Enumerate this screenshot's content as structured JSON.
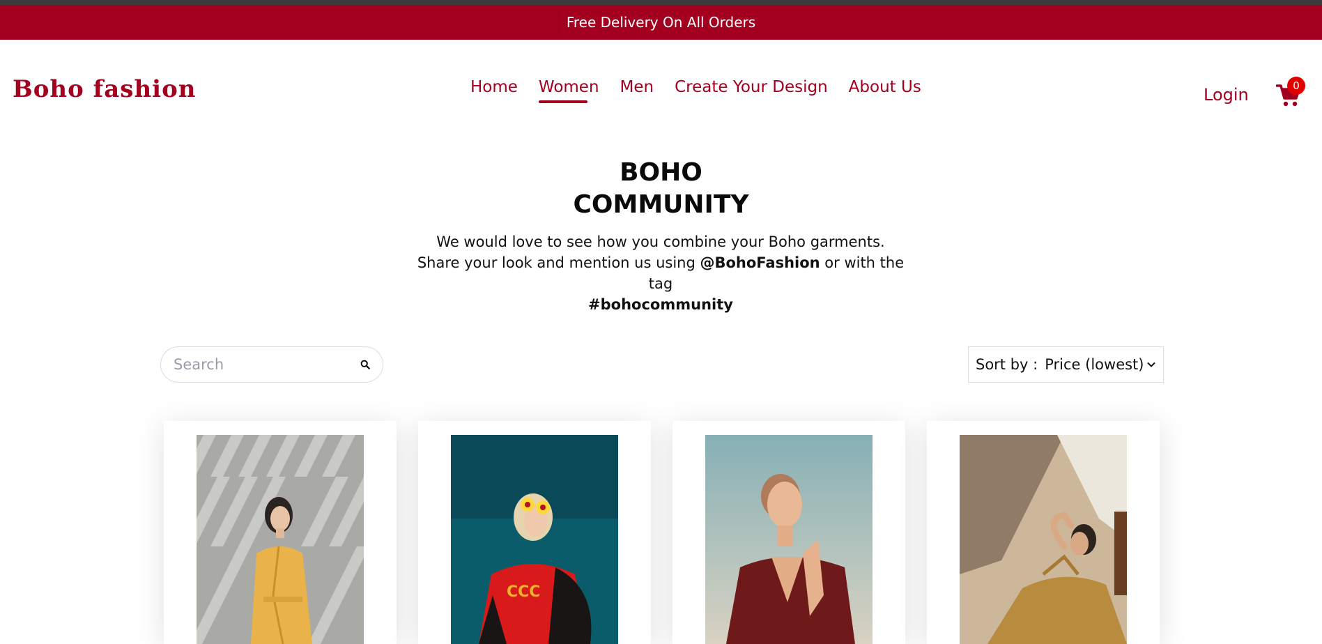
{
  "promo": {
    "text": "Free Delivery On All Orders"
  },
  "brand": {
    "logo": "Boho fashion"
  },
  "nav": {
    "items": [
      {
        "label": "Home",
        "active": false
      },
      {
        "label": "Women",
        "active": true
      },
      {
        "label": "Men",
        "active": false
      },
      {
        "label": "Create Your Design",
        "active": false
      },
      {
        "label": "About Us",
        "active": false
      }
    ]
  },
  "account": {
    "login_label": "Login",
    "cart_count": "0"
  },
  "hero": {
    "title_line1": "BOHO",
    "title_line2": "COMMUNITY",
    "text_before": "We would love to see how you combine your Boho garments. Share your look and mention us using ",
    "handle": "@BohoFashion",
    "text_middle": " or with the tag ",
    "tag": "#bohocommunity"
  },
  "search": {
    "placeholder": "Search",
    "value": ""
  },
  "sort": {
    "label": "Sort by :",
    "selected": "Price (lowest)"
  },
  "products": [
    {
      "alt": "Woman in yellow wrap dress against striped shadow wall"
    },
    {
      "alt": "Woman with flower sunglasses and red t-shirt on teal background"
    },
    {
      "alt": "Woman in dark red patterned top under blue sky"
    },
    {
      "alt": "Woman in mustard overalls lounging in sunlight"
    }
  ],
  "colors": {
    "brand": "#a3001f",
    "badge": "#e00000",
    "topline": "#3a3a3a"
  }
}
